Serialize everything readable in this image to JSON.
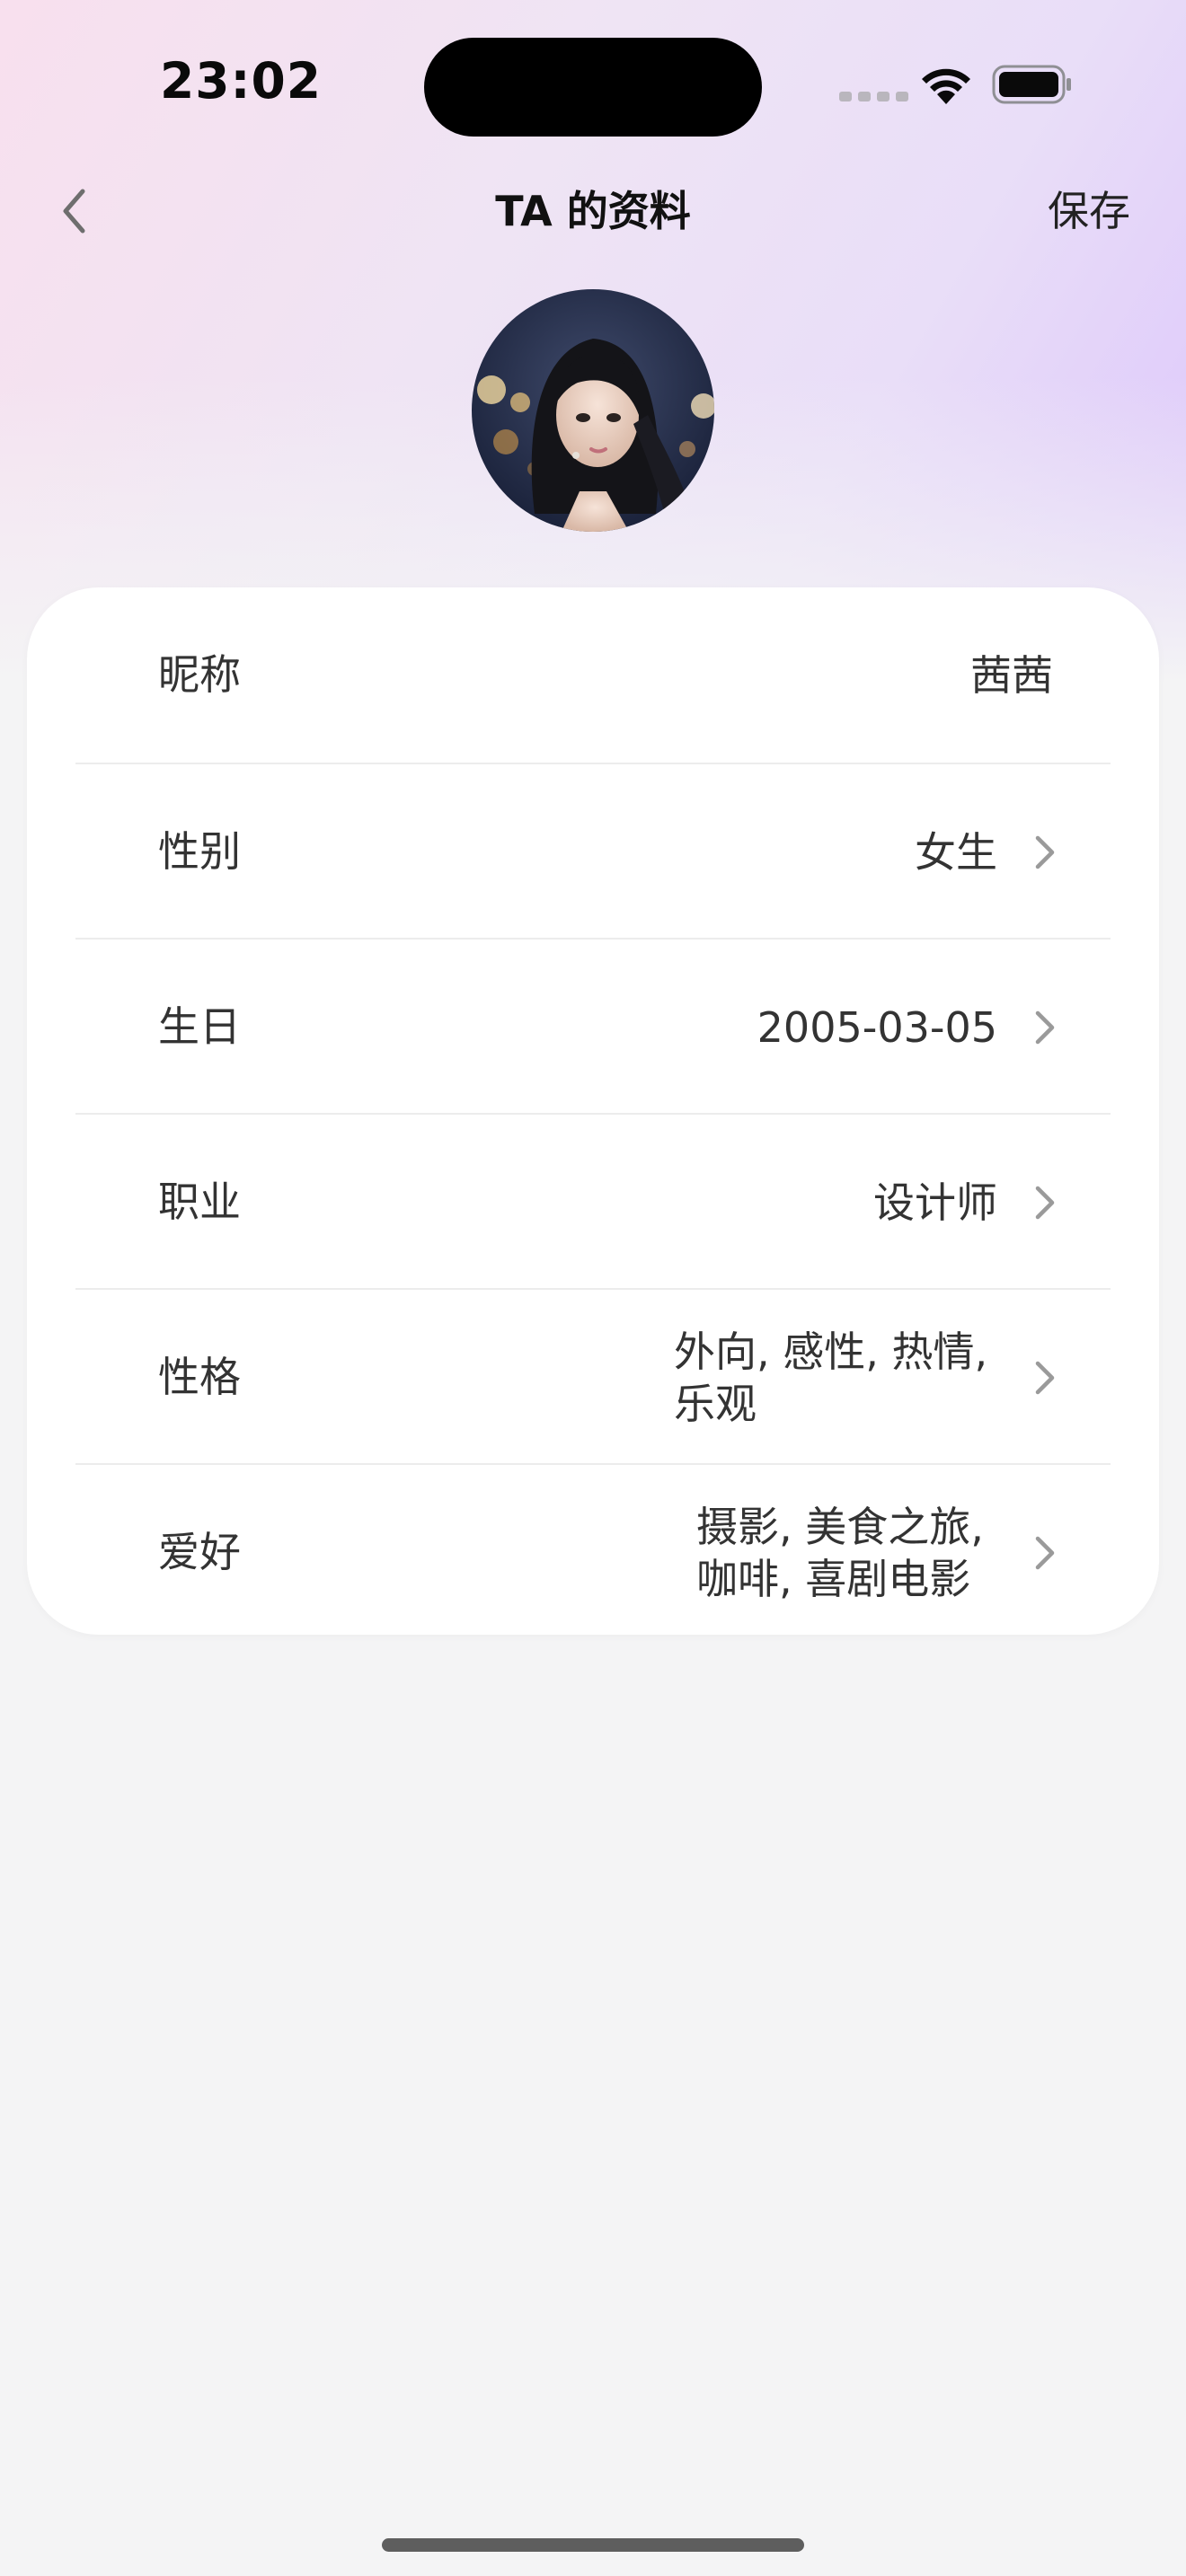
{
  "status_bar": {
    "time": "23:02"
  },
  "nav": {
    "title": "TA 的资料",
    "save_label": "保存"
  },
  "profile": {
    "avatar": "portrait-photo"
  },
  "fields": [
    {
      "label": "昵称",
      "value": "茜茜",
      "editable_arrow": false
    },
    {
      "label": "性别",
      "value": "女生",
      "editable_arrow": true
    },
    {
      "label": "生日",
      "value": "2005-03-05",
      "editable_arrow": true
    },
    {
      "label": "职业",
      "value": "设计师",
      "editable_arrow": true
    },
    {
      "label": "性格",
      "value": "外向, 感性, 热情, 乐观",
      "editable_arrow": true
    },
    {
      "label": "爱好",
      "value": "摄影, 美食之旅, 咖啡, 喜剧电影",
      "editable_arrow": true
    }
  ],
  "colors": {
    "gradient_pink": "#f8e0ee",
    "gradient_purple": "#dcc5fb",
    "page_bg": "#f4f4f5",
    "card_bg": "#ffffff",
    "divider": "#ececec",
    "chevron": "#9a9a9a"
  }
}
